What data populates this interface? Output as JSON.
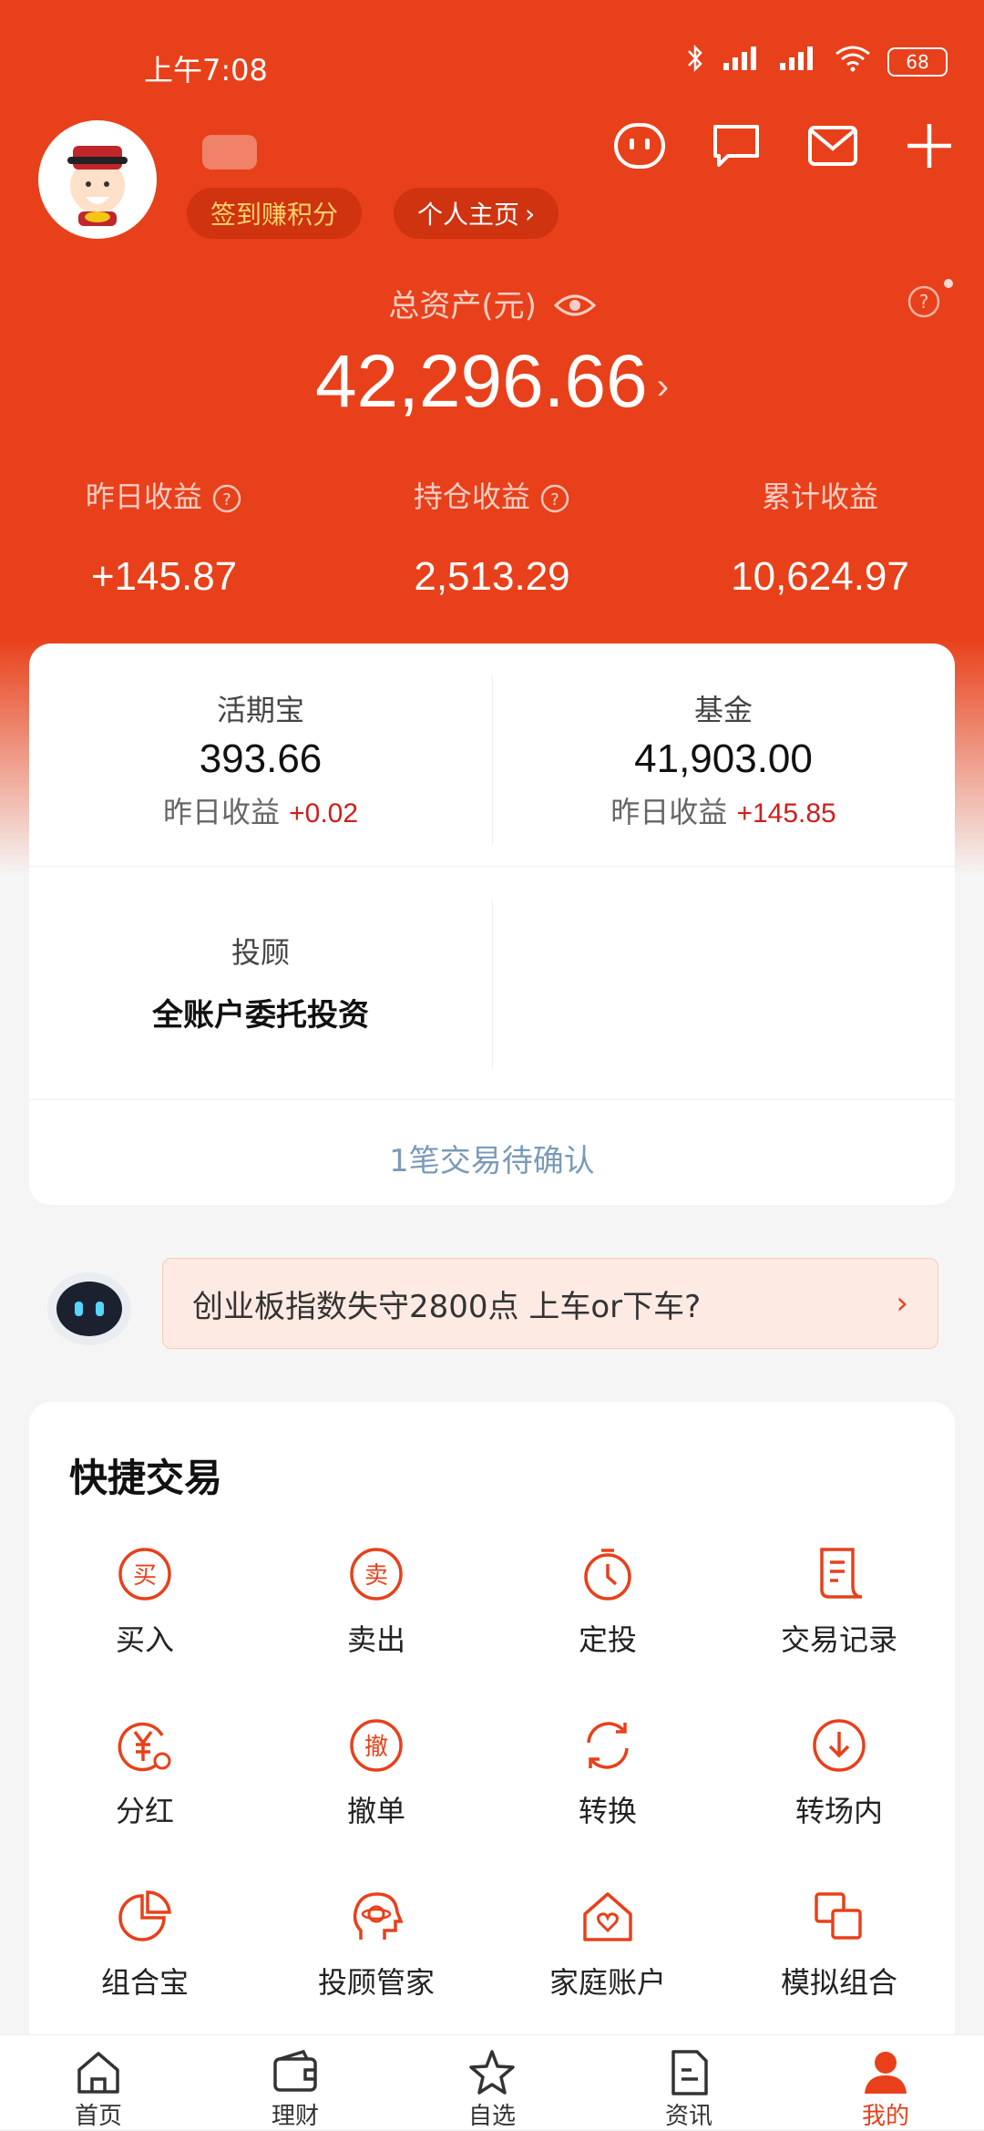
{
  "status": {
    "time": "上午7:08",
    "battery": "68"
  },
  "header": {
    "points_label": "签到赚积分",
    "homepage_label": "个人主页",
    "homepage_arrow": "›"
  },
  "assets": {
    "label": "总资产(元)",
    "value": "42,296.66",
    "arrow": "›"
  },
  "income": [
    {
      "label": "昨日收益",
      "value": "+145.87"
    },
    {
      "label": "持仓收益",
      "value": "2,513.29"
    },
    {
      "label": "累计收益",
      "value": "10,624.97"
    }
  ],
  "holdings": {
    "huoqibao": {
      "title": "活期宝",
      "value": "393.66",
      "sub_label": "昨日收益",
      "sub_value": "+0.02"
    },
    "fund": {
      "title": "基金",
      "value": "41,903.00",
      "sub_label": "昨日收益",
      "sub_value": "+145.85"
    },
    "advisor": {
      "title": "投顾",
      "value": "全账户委托投资"
    },
    "pending": "1笔交易待确认"
  },
  "banner": {
    "text": "创业板指数失守2800点 上车or下车?",
    "arrow": "›"
  },
  "quick_trade": {
    "title": "快捷交易",
    "items": [
      {
        "label": "买入",
        "icon": "buy-icon"
      },
      {
        "label": "卖出",
        "icon": "sell-icon"
      },
      {
        "label": "定投",
        "icon": "timer-icon"
      },
      {
        "label": "交易记录",
        "icon": "record-icon"
      },
      {
        "label": "分红",
        "icon": "dividend-icon"
      },
      {
        "label": "撤单",
        "icon": "cancel-order-icon"
      },
      {
        "label": "转换",
        "icon": "convert-icon"
      },
      {
        "label": "转场内",
        "icon": "transfer-in-icon"
      },
      {
        "label": "组合宝",
        "icon": "portfolio-icon"
      },
      {
        "label": "投顾管家",
        "icon": "advisor-icon"
      },
      {
        "label": "家庭账户",
        "icon": "family-account-icon"
      },
      {
        "label": "模拟组合",
        "icon": "simulate-icon"
      }
    ],
    "glyphs": {
      "buy": "买",
      "sell": "卖",
      "cancel": "撤"
    }
  },
  "tabs": [
    {
      "label": "首页",
      "icon": "home-icon"
    },
    {
      "label": "理财",
      "icon": "wallet-icon"
    },
    {
      "label": "自选",
      "icon": "star-icon"
    },
    {
      "label": "资讯",
      "icon": "news-icon"
    },
    {
      "label": "我的",
      "icon": "profile-icon",
      "active": true
    }
  ],
  "colors": {
    "brand": "#e8401a",
    "gain": "#d11d1d",
    "pending": "#7a9bb8"
  }
}
